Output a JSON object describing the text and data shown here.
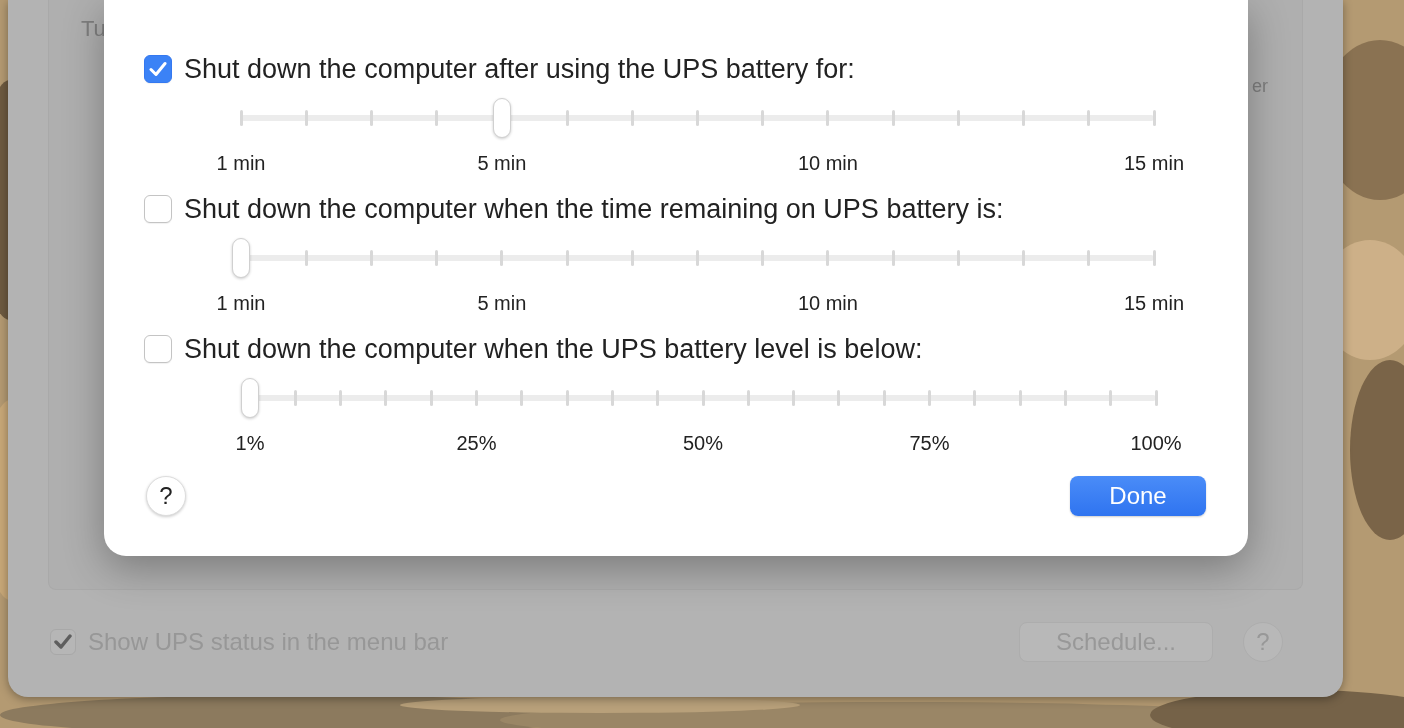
{
  "background_window": {
    "partial_labels": [
      "Tu",
      "er"
    ],
    "status_option": {
      "label": "Show UPS status in the menu bar",
      "checked": true
    },
    "schedule_button": "Schedule...",
    "help_button": "?"
  },
  "sheet": {
    "options": [
      {
        "label": "Shut down the computer after using the UPS battery for:",
        "checked": true,
        "kind": "minutes",
        "level": 0.2857,
        "scale_labels": [
          "1 min",
          "5 min",
          "10 min",
          "15 min"
        ]
      },
      {
        "label": "Shut down the computer when the time remaining on UPS battery is:",
        "checked": false,
        "kind": "minutes",
        "level": 0,
        "scale_labels": [
          "1 min",
          "5 min",
          "10 min",
          "15 min"
        ]
      },
      {
        "label": "Shut down the computer when the UPS battery level is below:",
        "checked": false,
        "kind": "percent",
        "level": 0,
        "scale_labels": [
          "1%",
          "25%",
          "50%",
          "75%",
          "100%"
        ]
      }
    ],
    "help_button": "?",
    "done_button": "Done"
  }
}
